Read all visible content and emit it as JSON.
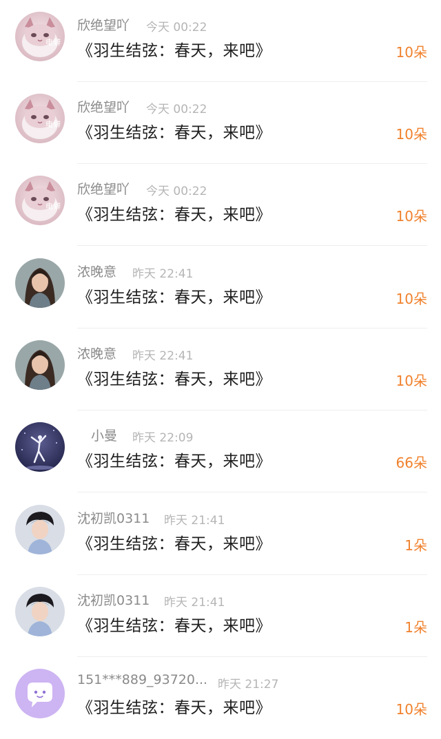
{
  "colors": {
    "name": "#8a8a8a",
    "time": "#b5b5b5",
    "title": "#1f1f1f",
    "count_accent": "#f0812c",
    "divider": "#eeeeee"
  },
  "items": [
    {
      "avatar": "cat-avatar",
      "avatar_tag": "电僻",
      "name": "欣绝望吖",
      "time": "今天 00:22",
      "title": "《羽生结弦：春天，来吧》",
      "count": "10朵"
    },
    {
      "avatar": "cat-avatar",
      "avatar_tag": "电僻",
      "name": "欣绝望吖",
      "time": "今天 00:22",
      "title": "《羽生结弦：春天，来吧》",
      "count": "10朵"
    },
    {
      "avatar": "cat-avatar",
      "avatar_tag": "电僻",
      "name": "欣绝望吖",
      "time": "今天 00:22",
      "title": "《羽生结弦：春天，来吧》",
      "count": "10朵"
    },
    {
      "avatar": "woman-portrait-avatar",
      "name": "浓晚意",
      "time": "昨天 22:41",
      "title": "《羽生结弦：春天，来吧》",
      "count": "10朵"
    },
    {
      "avatar": "woman-portrait-avatar",
      "name": "浓晚意",
      "time": "昨天 22:41",
      "title": "《羽生结弦：春天，来吧》",
      "count": "10朵"
    },
    {
      "avatar": "skater-avatar",
      "name": "小曼",
      "time": "昨天 22:09",
      "title": "《羽生结弦：春天，来吧》",
      "count": "66朵"
    },
    {
      "avatar": "man-portrait-avatar",
      "name": "沈初凯0311",
      "time": "昨天 21:41",
      "title": "《羽生结弦：春天，来吧》",
      "count": "1朵"
    },
    {
      "avatar": "man-portrait-avatar",
      "name": "沈初凯0311",
      "time": "昨天 21:41",
      "title": "《羽生结弦：春天，来吧》",
      "count": "1朵"
    },
    {
      "avatar": "chat-bubble-avatar",
      "name": "151***889_93720...",
      "time": "昨天 21:27",
      "title": "《羽生结弦：春天，来吧》",
      "count": "10朵"
    }
  ]
}
